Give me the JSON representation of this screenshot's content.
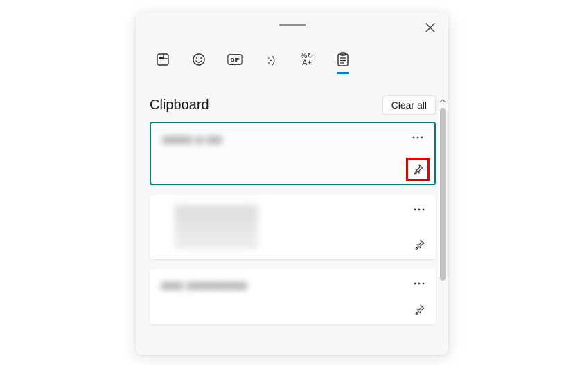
{
  "panel": {
    "title": "Clipboard",
    "clear_all_label": "Clear all"
  },
  "tabs": [
    {
      "name": "stickers",
      "active": false
    },
    {
      "name": "emoji",
      "active": false
    },
    {
      "name": "gif",
      "active": false
    },
    {
      "name": "kaomoji",
      "active": false
    },
    {
      "name": "symbols",
      "active": false
    },
    {
      "name": "clipboard",
      "active": true
    }
  ],
  "items": [
    {
      "id": 0,
      "type": "text",
      "preview": "■■■■ ■ ■■",
      "selected": true,
      "pinned": false,
      "pin_highlighted": true
    },
    {
      "id": 1,
      "type": "image",
      "preview": "",
      "selected": false,
      "pinned": false,
      "pin_highlighted": false
    },
    {
      "id": 2,
      "type": "text",
      "preview": "■■■ ■■■■■■■■",
      "selected": false,
      "pinned": false,
      "pin_highlighted": false
    }
  ]
}
